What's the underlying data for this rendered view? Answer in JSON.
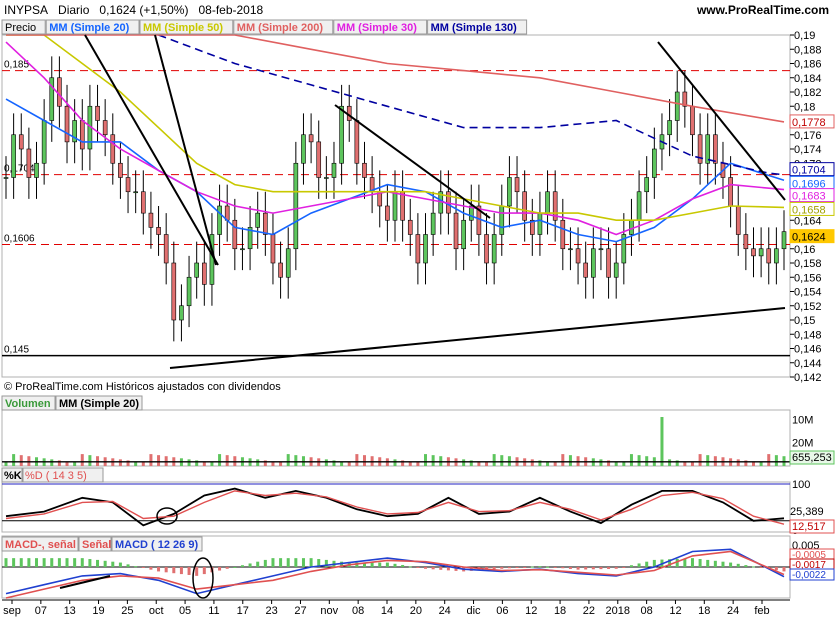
{
  "header": {
    "symbol": "INYPSA",
    "period": "Diario",
    "last": "0,1624 (+1,50%)",
    "date": "08-feb-2018",
    "site": "www.ProRealTime.com"
  },
  "price_panel": {
    "legend": [
      {
        "label": "Precio",
        "color": "#000000"
      },
      {
        "label": "MM (Simple 20)",
        "color": "#1565ff"
      },
      {
        "label": "MM (Simple 50)",
        "color": "#c8c800"
      },
      {
        "label": "MM (Simple 200)",
        "color": "#e06060"
      },
      {
        "label": "MM (Simple 30)",
        "color": "#e020e0"
      },
      {
        "label": "MM (Simple 130)",
        "color": "#0000a0"
      }
    ],
    "copyright": "© ProRealTime.com Históricos ajustados con dividendos",
    "level_labels": [
      "0,185",
      "0,1704",
      "0,1606",
      "0,145"
    ],
    "value_tags": [
      {
        "label": "0,1778",
        "color": "#e06060",
        "text": "#c00000"
      },
      {
        "label": "0,1704",
        "color": "#0000a0",
        "text": "#0000a0"
      },
      {
        "label": "0,1696",
        "color": "#1565ff",
        "text": "#1565ff"
      },
      {
        "label": "0,1683",
        "color": "#e020e0",
        "text": "#e020e0"
      },
      {
        "label": "0,1658",
        "color": "#c8c800",
        "text": "#a0a000"
      },
      {
        "label": "0,1624",
        "color": "#ffc800",
        "text": "#000000"
      }
    ]
  },
  "volume_panel": {
    "legend": [
      "Volumen",
      "MM (Simple 20)"
    ],
    "tick_labels": [
      "20M",
      "10M"
    ],
    "value_tag": "655,253"
  },
  "stoch_panel": {
    "legend": [
      "%K",
      "%D ( 14 3 5)"
    ],
    "tick_labels": [
      "100",
      "0"
    ],
    "value_tags": [
      "25,389",
      "12,517"
    ]
  },
  "macd_panel": {
    "legend": [
      "MACD-, señal",
      "Señal",
      "MACD ( 12 26 9)"
    ],
    "tick_labels": [
      "0,005",
      "0"
    ],
    "value_tags": [
      "-0,0005",
      "-0,0017",
      "-0,0022"
    ]
  },
  "x_axis_labels": [
    "sep",
    "07",
    "13",
    "19",
    "25",
    "oct",
    "05",
    "11",
    "17",
    "23",
    "27",
    "nov",
    "08",
    "14",
    "20",
    "24",
    "dic",
    "06",
    "12",
    "18",
    "22",
    "2018",
    "08",
    "12",
    "18",
    "24",
    "feb"
  ],
  "chart_data": [
    {
      "type": "candlestick",
      "title": "INYPSA Diario",
      "ylim": [
        0.142,
        0.19
      ],
      "y_ticks": [
        0.142,
        0.144,
        0.146,
        0.148,
        0.15,
        0.152,
        0.154,
        0.156,
        0.158,
        0.16,
        0.162,
        0.164,
        0.166,
        0.168,
        0.17,
        0.172,
        0.174,
        0.176,
        0.178,
        0.18,
        0.182,
        0.184,
        0.186,
        0.188,
        0.19
      ],
      "reference_levels": [
        0.185,
        0.1704,
        0.1606,
        0.145
      ],
      "close": [
        0.17,
        0.176,
        0.174,
        0.17,
        0.172,
        0.178,
        0.184,
        0.18,
        0.175,
        0.178,
        0.174,
        0.18,
        0.178,
        0.176,
        0.172,
        0.17,
        0.168,
        0.168,
        0.165,
        0.163,
        0.162,
        0.158,
        0.15,
        0.152,
        0.156,
        0.158,
        0.155,
        0.162,
        0.166,
        0.164,
        0.16,
        0.16,
        0.163,
        0.165,
        0.162,
        0.158,
        0.156,
        0.16,
        0.172,
        0.176,
        0.175,
        0.17,
        0.17,
        0.172,
        0.18,
        0.178,
        0.172,
        0.17,
        0.168,
        0.166,
        0.164,
        0.168,
        0.164,
        0.162,
        0.158,
        0.162,
        0.165,
        0.168,
        0.165,
        0.16,
        0.164,
        0.166,
        0.162,
        0.158,
        0.162,
        0.166,
        0.17,
        0.168,
        0.164,
        0.162,
        0.165,
        0.168,
        0.164,
        0.16,
        0.16,
        0.158,
        0.156,
        0.16,
        0.16,
        0.156,
        0.158,
        0.162,
        0.164,
        0.168,
        0.17,
        0.174,
        0.176,
        0.178,
        0.182,
        0.18,
        0.176,
        0.172,
        0.176,
        0.172,
        0.17,
        0.166,
        0.162,
        0.16,
        0.159,
        0.16,
        0.158,
        0.16,
        0.1624
      ],
      "series": [
        {
          "name": "MM (Simple 20)",
          "x": [
            0,
            5,
            10,
            15,
            20,
            25,
            30,
            35,
            40,
            45,
            50,
            55,
            60,
            65,
            70,
            75,
            80,
            85,
            90,
            95,
            102
          ],
          "values": [
            0.181,
            0.178,
            0.175,
            0.175,
            0.171,
            0.168,
            0.163,
            0.162,
            0.165,
            0.167,
            0.169,
            0.168,
            0.165,
            0.163,
            0.164,
            0.162,
            0.161,
            0.163,
            0.167,
            0.172,
            0.1696
          ]
        },
        {
          "name": "MM (Simple 30)",
          "x": [
            0,
            5,
            10,
            15,
            20,
            25,
            30,
            35,
            40,
            45,
            50,
            55,
            60,
            65,
            70,
            75,
            80,
            85,
            90,
            95,
            102
          ],
          "values": [
            0.189,
            0.184,
            0.178,
            0.174,
            0.171,
            0.168,
            0.166,
            0.165,
            0.166,
            0.167,
            0.168,
            0.167,
            0.166,
            0.165,
            0.165,
            0.164,
            0.162,
            0.164,
            0.167,
            0.169,
            0.1683
          ]
        },
        {
          "name": "MM (Simple 50)",
          "x": [
            0,
            5,
            10,
            15,
            20,
            25,
            30,
            35,
            40,
            45,
            50,
            55,
            60,
            65,
            70,
            75,
            80,
            85,
            90,
            95,
            102
          ],
          "values": [
            0.194,
            0.19,
            0.186,
            0.182,
            0.177,
            0.172,
            0.169,
            0.168,
            0.168,
            0.168,
            0.168,
            0.168,
            0.167,
            0.166,
            0.165,
            0.165,
            0.164,
            0.164,
            0.165,
            0.166,
            0.1658
          ]
        },
        {
          "name": "MM (Simple 130)",
          "x": [
            20,
            30,
            40,
            50,
            60,
            70,
            80,
            90,
            100,
            102
          ],
          "values": [
            0.19,
            0.186,
            0.183,
            0.18,
            0.177,
            0.177,
            0.178,
            0.173,
            0.1706,
            0.1704
          ]
        },
        {
          "name": "MM (Simple 200)",
          "x": [
            0,
            10,
            20,
            30,
            40,
            50,
            60,
            70,
            80,
            90,
            102
          ],
          "values": [
            0.198,
            0.196,
            0.193,
            0.19,
            0.188,
            0.186,
            0.185,
            0.184,
            0.182,
            0.18,
            0.1778
          ]
        }
      ]
    },
    {
      "type": "bar",
      "title": "Volumen",
      "ylim": [
        0,
        24000000
      ],
      "y_ticks": [
        10000000,
        20000000
      ],
      "peak": {
        "index": 86,
        "value": 21000000
      },
      "last": 655253
    },
    {
      "type": "line",
      "title": "%K / %D ( 14 3 5)",
      "ylim": [
        0,
        100
      ],
      "y_ticks": [
        0,
        100
      ],
      "series": [
        {
          "name": "%K",
          "x": [
            0,
            5,
            10,
            14,
            18,
            22,
            26,
            30,
            34,
            38,
            42,
            46,
            50,
            54,
            58,
            62,
            66,
            70,
            74,
            78,
            82,
            86,
            90,
            94,
            98,
            102
          ],
          "values": [
            30,
            40,
            70,
            60,
            10,
            35,
            75,
            90,
            70,
            85,
            70,
            45,
            30,
            35,
            70,
            35,
            40,
            70,
            40,
            15,
            55,
            85,
            85,
            60,
            20,
            25.389
          ]
        },
        {
          "name": "%D",
          "x": [
            0,
            5,
            10,
            14,
            18,
            22,
            26,
            30,
            34,
            38,
            42,
            46,
            50,
            54,
            58,
            62,
            66,
            70,
            74,
            78,
            82,
            86,
            90,
            94,
            98,
            102
          ],
          "values": [
            25,
            35,
            60,
            62,
            25,
            30,
            60,
            85,
            75,
            80,
            72,
            50,
            35,
            38,
            60,
            40,
            42,
            60,
            45,
            22,
            45,
            75,
            82,
            68,
            30,
            12.517
          ]
        }
      ]
    },
    {
      "type": "line",
      "title": "MACD ( 12 26 9)",
      "ylim": [
        -0.007,
        0.007
      ],
      "y_ticks": [
        0,
        0.005
      ],
      "series": [
        {
          "name": "MACD",
          "x": [
            0,
            5,
            10,
            15,
            20,
            25,
            30,
            35,
            40,
            45,
            50,
            55,
            60,
            65,
            70,
            75,
            80,
            85,
            90,
            95,
            102
          ],
          "values": [
            -0.006,
            -0.004,
            -0.002,
            -0.0015,
            -0.003,
            -0.006,
            -0.004,
            -0.002,
            0.0,
            0.001,
            0.002,
            0.001,
            -0.0005,
            -0.001,
            -0.0005,
            -0.0015,
            -0.002,
            0.0,
            0.0035,
            0.004,
            -0.0022
          ]
        },
        {
          "name": "Señal",
          "x": [
            0,
            5,
            10,
            15,
            20,
            25,
            30,
            35,
            40,
            45,
            50,
            55,
            60,
            65,
            70,
            75,
            80,
            85,
            90,
            95,
            102
          ],
          "values": [
            -0.007,
            -0.005,
            -0.003,
            -0.002,
            -0.0025,
            -0.005,
            -0.004,
            -0.003,
            -0.001,
            0.0005,
            0.0015,
            0.0012,
            0.0,
            -0.0008,
            -0.0006,
            -0.0012,
            -0.0018,
            -0.0008,
            0.0025,
            0.0035,
            -0.0017
          ]
        }
      ],
      "last_difference": -0.0005
    }
  ]
}
